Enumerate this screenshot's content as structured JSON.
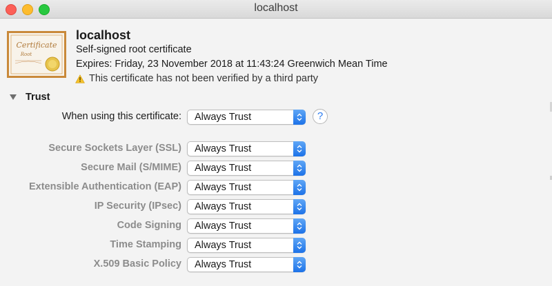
{
  "window": {
    "title": "localhost"
  },
  "certificate": {
    "name": "localhost",
    "type": "Self-signed root certificate",
    "expires": "Expires: Friday, 23 November 2018 at 11:43:24 Greenwich Mean Time",
    "warning": "This certificate has not been verified by a third party",
    "icon_text": "Certificate",
    "icon_subtext": "Root"
  },
  "trust": {
    "section_label": "Trust",
    "main_label": "When using this certificate:",
    "main_value": "Always Trust",
    "help_label": "?",
    "rows": [
      {
        "label": "Secure Sockets Layer (SSL)",
        "value": "Always Trust"
      },
      {
        "label": "Secure Mail (S/MIME)",
        "value": "Always Trust"
      },
      {
        "label": "Extensible Authentication (EAP)",
        "value": "Always Trust"
      },
      {
        "label": "IP Security (IPsec)",
        "value": "Always Trust"
      },
      {
        "label": "Code Signing",
        "value": "Always Trust"
      },
      {
        "label": "Time Stamping",
        "value": "Always Trust"
      },
      {
        "label": "X.509 Basic Policy",
        "value": "Always Trust"
      }
    ]
  },
  "colors": {
    "accent": "#1c72e8",
    "disabled_label": "#8c8c8c"
  }
}
